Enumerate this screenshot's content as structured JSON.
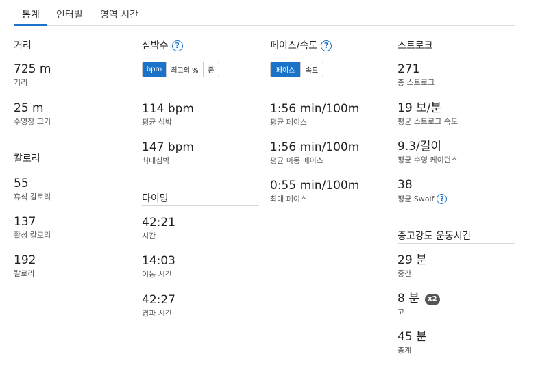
{
  "tabs": [
    {
      "label": "통계"
    },
    {
      "label": "인터벌"
    },
    {
      "label": "영역 시간"
    }
  ],
  "distance": {
    "title": "거리",
    "stats": [
      {
        "value": "725 m",
        "label": "거리"
      },
      {
        "value": "25 m",
        "label": "수영장 크기"
      }
    ]
  },
  "calories": {
    "title": "칼로리",
    "stats": [
      {
        "value": "55",
        "label": "휴식 칼로리"
      },
      {
        "value": "137",
        "label": "활성 칼로리"
      },
      {
        "value": "192",
        "label": "칼로리"
      }
    ]
  },
  "heart_rate": {
    "title": "심박수",
    "toggle": {
      "bpm": "bpm",
      "max_pct": "최고의 %",
      "zone": "존"
    },
    "stats": [
      {
        "value": "114 bpm",
        "label": "평균 심박"
      },
      {
        "value": "147 bpm",
        "label": "최대심박"
      }
    ]
  },
  "timing": {
    "title": "타이밍",
    "stats": [
      {
        "value": "42:21",
        "label": "시간"
      },
      {
        "value": "14:03",
        "label": "이동 시간"
      },
      {
        "value": "42:27",
        "label": "경과 시간"
      }
    ]
  },
  "pace": {
    "title": "페이스/속도",
    "toggle": {
      "pace": "페이스",
      "speed": "속도"
    },
    "stats": [
      {
        "value": "1:56 min/100m",
        "label": "평균 페이스"
      },
      {
        "value": "1:56 min/100m",
        "label": "평균 이동 페이스"
      },
      {
        "value": "0:55 min/100m",
        "label": "최대 페이스"
      }
    ]
  },
  "stroke": {
    "title": "스트로크",
    "stats": [
      {
        "value": "271",
        "label": "총 스트로크"
      },
      {
        "value": "19 보/분",
        "label": "평균 스트로크 속도"
      },
      {
        "value": "9.3/길이",
        "label": "평균 수영 케이던스"
      },
      {
        "value": "38",
        "label": "평균 Swolf"
      }
    ]
  },
  "intensity": {
    "title": "중고강도 운동시간",
    "stats": [
      {
        "value": "29 분",
        "label": "중간"
      },
      {
        "value": "8 분",
        "label": "고",
        "badge": "x2"
      },
      {
        "value": "45 분",
        "label": "총계"
      }
    ]
  },
  "icons": {
    "help": "help-circle-icon",
    "multiplier": "x2-badge"
  },
  "colors": {
    "accent": "#1a73c8",
    "badge": "#555555",
    "divider": "#d6d6d6"
  }
}
